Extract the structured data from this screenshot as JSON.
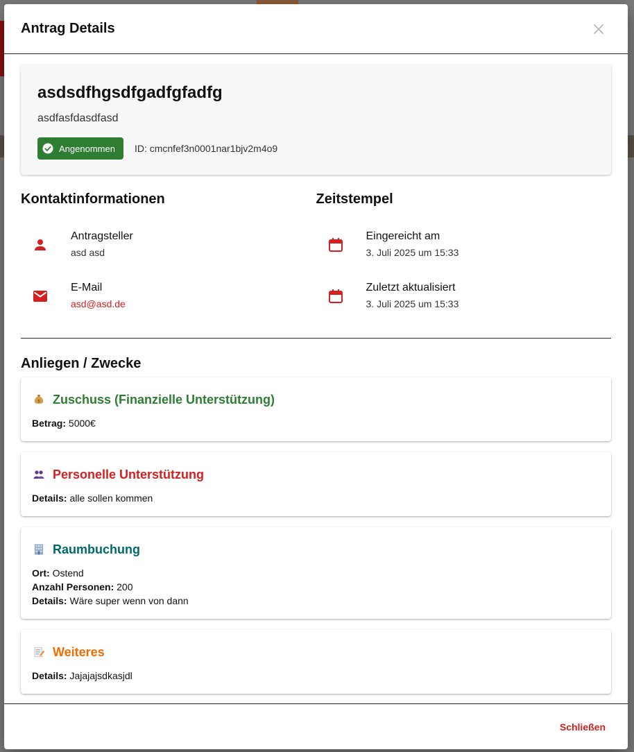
{
  "modal": {
    "title": "Antrag Details",
    "close_icon": "close-icon",
    "footer_close_label": "Schließen"
  },
  "summary": {
    "title": "asdsdfhgsdfgadfgfadfg",
    "description": "asdfasfdasdfasd",
    "status": {
      "label": "Angenommen",
      "icon": "check-circle-icon",
      "color": "#2e7d32"
    },
    "id_text": "ID: cmcnfef3n0001nar1bjv2m4o9"
  },
  "contact": {
    "title": "Kontaktinformationen",
    "items": [
      {
        "icon": "person-icon",
        "label": "Antragsteller",
        "value": "asd asd"
      },
      {
        "icon": "mail-icon",
        "label": "E-Mail",
        "value": "asd@asd.de"
      }
    ]
  },
  "timestamps": {
    "title": "Zeitstempel",
    "items": [
      {
        "icon": "calendar-icon",
        "label": "Eingereicht am",
        "value": "3. Juli 2025 um 15:33"
      },
      {
        "icon": "calendar-icon",
        "label": "Zuletzt aktualisiert",
        "value": "3. Juli 2025 um 15:33"
      }
    ]
  },
  "purposes": {
    "title": "Anliegen / Zwecke",
    "items": [
      {
        "emoji": "money-bag-icon",
        "name": "Zuschuss (Finanzielle Unterstützung)",
        "color": "#2e7d32",
        "rows": [
          {
            "key": "Betrag:",
            "value": "5000€"
          }
        ]
      },
      {
        "emoji": "people-icon",
        "name": "Personelle Unterstützung",
        "color": "#d32020",
        "rows": [
          {
            "key": "Details:",
            "value": "alle sollen kommen"
          }
        ]
      },
      {
        "emoji": "office-building-icon",
        "name": "Raumbuchung",
        "color": "#00696b",
        "rows": [
          {
            "key": "Ort:",
            "value": "Ostend"
          },
          {
            "key": "Anzahl Personen:",
            "value": "200"
          },
          {
            "key": "Details:",
            "value": "Wäre super wenn von dann"
          }
        ]
      },
      {
        "emoji": "memo-icon",
        "name": "Weiteres",
        "color": "#ef6c00",
        "rows": [
          {
            "key": "Details:",
            "value": "Jajajajsdkasjdl"
          }
        ]
      }
    ]
  },
  "colors": {
    "accent_red": "#d32020",
    "success_green": "#2e7d32"
  }
}
